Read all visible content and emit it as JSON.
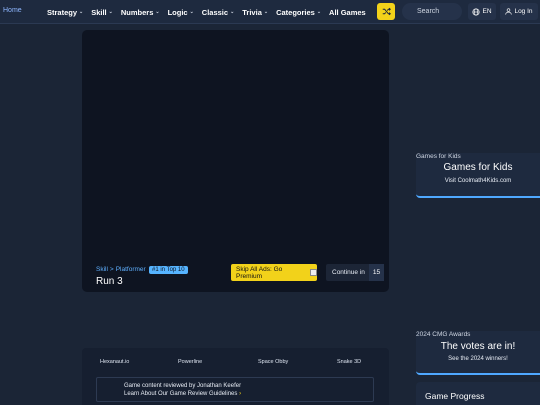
{
  "nav": {
    "logo_alt": "Home",
    "menu": [
      {
        "label": "Strategy",
        "has_dropdown": true
      },
      {
        "label": "Skill",
        "has_dropdown": true
      },
      {
        "label": "Numbers",
        "has_dropdown": true
      },
      {
        "label": "Logic",
        "has_dropdown": true
      },
      {
        "label": "Classic",
        "has_dropdown": true
      },
      {
        "label": "Trivia",
        "has_dropdown": true
      },
      {
        "label": "Categories",
        "has_dropdown": true
      },
      {
        "label": "All Games",
        "has_dropdown": false
      }
    ],
    "shuffle_icon": "shuffle-icon",
    "search_placeholder": "Search",
    "lang_label": "EN",
    "login_label": "Log In"
  },
  "game": {
    "breadcrumb_category": "Skill",
    "breadcrumb_sep": ">",
    "breadcrumb_sub": "Platformer",
    "rank": "#1 in Top 10",
    "title": "Run 3",
    "premium_label": "Skip All Ads: Go Premium",
    "continue_label": "Continue in",
    "continue_count": "15"
  },
  "sidebar": {
    "kids": {
      "alt": "Games for Kids",
      "title": "Games for Kids",
      "sub": "Visit Coolmath4Kids.com"
    },
    "awards": {
      "alt": "2024 CMG Awards",
      "title": "The votes are in!",
      "sub": "See the 2024 winners!"
    },
    "progress_title": "Game Progress"
  },
  "related": {
    "games": [
      "Hexanaut.io",
      "Powerline",
      "Space Obby",
      "Snake 3D"
    ],
    "review_text": "Game content reviewed by Jonathan Keefer",
    "guidelines_text": "Learn About Our Game Review Guidelines",
    "guidelines_arrow": "›"
  },
  "colors": {
    "accent_yellow": "#f2d21a",
    "accent_blue": "#4fa8ff",
    "background": "#1b2536"
  }
}
